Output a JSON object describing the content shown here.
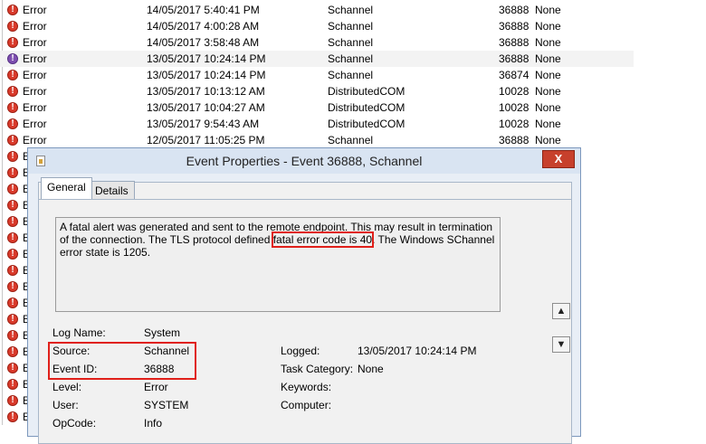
{
  "events": [
    {
      "level": "Error",
      "date": "14/05/2017 5:40:41 PM",
      "source": "Schannel",
      "id": "36888",
      "task": "None"
    },
    {
      "level": "Error",
      "date": "14/05/2017 4:00:28 AM",
      "source": "Schannel",
      "id": "36888",
      "task": "None"
    },
    {
      "level": "Error",
      "date": "14/05/2017 3:58:48 AM",
      "source": "Schannel",
      "id": "36888",
      "task": "None"
    },
    {
      "level": "Error",
      "date": "13/05/2017 10:24:14 PM",
      "source": "Schannel",
      "id": "36888",
      "task": "None"
    },
    {
      "level": "Error",
      "date": "13/05/2017 10:24:14 PM",
      "source": "Schannel",
      "id": "36874",
      "task": "None"
    },
    {
      "level": "Error",
      "date": "13/05/2017 10:13:12 AM",
      "source": "DistributedCOM",
      "id": "10028",
      "task": "None"
    },
    {
      "level": "Error",
      "date": "13/05/2017 10:04:27 AM",
      "source": "DistributedCOM",
      "id": "10028",
      "task": "None"
    },
    {
      "level": "Error",
      "date": "13/05/2017 9:54:43 AM",
      "source": "DistributedCOM",
      "id": "10028",
      "task": "None"
    },
    {
      "level": "Error",
      "date": "12/05/2017 11:05:25 PM",
      "source": "Schannel",
      "id": "36888",
      "task": "None"
    }
  ],
  "truncated_level": "E",
  "dialog": {
    "title": "Event Properties - Event 36888, Schannel",
    "close_label": "X",
    "tabs": {
      "general": "General",
      "details": "Details"
    },
    "description": {
      "before": "A fatal alert was generated and sent to the remote endpoint. This may result in termination of the connection. The TLS protocol defined ",
      "highlight": "fatal error code is 40",
      "after": ". The Windows SChannel error state is 1205."
    },
    "fields": {
      "log_name": {
        "label": "Log Name:",
        "value": "System"
      },
      "source": {
        "label": "Source:",
        "value": "Schannel"
      },
      "event_id": {
        "label": "Event ID:",
        "value": "36888"
      },
      "level": {
        "label": "Level:",
        "value": "Error"
      },
      "user": {
        "label": "User:",
        "value": "SYSTEM"
      },
      "opcode": {
        "label": "OpCode:",
        "value": "Info"
      },
      "logged": {
        "label": "Logged:",
        "value": "13/05/2017 10:24:14 PM"
      },
      "task_category": {
        "label": "Task Category:",
        "value": "None"
      },
      "keywords": {
        "label": "Keywords:",
        "value": ""
      },
      "computer": {
        "label": "Computer:",
        "value": ""
      }
    },
    "scroll_up_icon": "▲",
    "scroll_down_icon": "▼"
  },
  "colors": {
    "error_icon": "#d93a2b",
    "highlight_box": "#e0201a"
  }
}
